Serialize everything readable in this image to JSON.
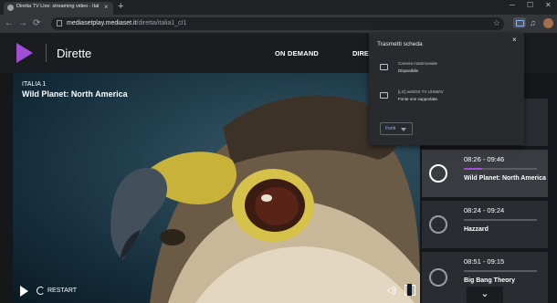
{
  "browser": {
    "tab_title": "Diretta TV Live: streaming video - Italia 1 | M",
    "tab_close": "×",
    "new_tab": "+",
    "window_min": "─",
    "window_max": "☐",
    "window_close": "✕",
    "url_host": "mediasetplay.mediaset.it",
    "url_path": "/diretta/italia1_cI1",
    "nav_back": "←",
    "nav_forward": "→",
    "nav_reload": "⟳",
    "bookmark_star": "☆"
  },
  "site": {
    "section_title": "Dirette",
    "nav_ondemand": "ON DEMAND",
    "nav_dirette": "DIRE"
  },
  "player": {
    "channel": "ITALIA 1",
    "title": "Wild Planet: North America",
    "restart_label": "RESTART",
    "volume_glyph": "◁)",
    "scroll_down": "⌄"
  },
  "schedule": [
    {
      "time": "08:26 - 09:46",
      "name": "Wild Planet: North America",
      "progress": 0.25,
      "active": true
    },
    {
      "time": "08:24 - 09:24",
      "name": "Hazzard",
      "progress": 0,
      "active": false
    },
    {
      "time": "08:51 - 09:15",
      "name": "Big Bang Theory",
      "progress": 0,
      "active": false
    }
  ],
  "cast_popup": {
    "title": "Trasmetti scheda",
    "close": "×",
    "devices": [
      {
        "name": "Camera matrimoniale",
        "status": "Disponibile"
      },
      {
        "name": "[LG] webOS TV UH650V",
        "status": "Fonte non supportata"
      }
    ],
    "sources_label": "Fonti"
  },
  "colors": {
    "accent": "#a24dd6",
    "header_bg": "#1b1c20",
    "card_bg": "#2b2c31"
  }
}
